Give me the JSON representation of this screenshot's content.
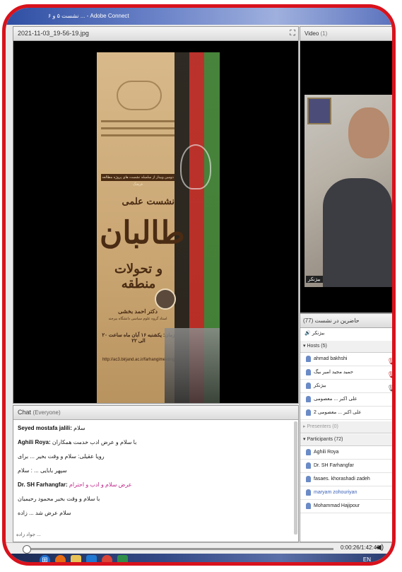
{
  "window": {
    "title": "نشست ۵ و ۶ ... - Adobe Connect"
  },
  "share": {
    "title": "2021-11-03_19-56-19.jpg",
    "fullscreen_icon": "expand-icon",
    "poster": {
      "series": "نشست علمی",
      "band": "دومین وبینار از سلسله نشست های پروژه مطالعه فرهنگ",
      "main_title": "طالبان",
      "subtitle": "و تحولات منطقه",
      "speaker": "دکتر احمد بخشی",
      "speaker_role": "استاد گروه علوم سیاسی دانشگاه بیرجند",
      "datetime": "زمان: یکشنبه ۱۶ آبان ماه ساعت ۲۰ الی ۲۲",
      "link": "http://ac3.birjand.ac.ir/farhangimeeting"
    }
  },
  "video": {
    "title": "Video",
    "count": "(1)",
    "speaker_label": "بیژنکر"
  },
  "attendees": {
    "title": "حاضرین در نشست",
    "count": "(77)",
    "speaking_now": "بیژنکر",
    "hosts_label": "Hosts (5)",
    "hosts": [
      {
        "name": "ahmad bakhshi",
        "mic": true
      },
      {
        "name": "حمید مجید امیر بیگ",
        "mic": true
      },
      {
        "name": "بیژنکر",
        "mic": true
      },
      {
        "name": "علی اکبر ... معصومی",
        "mic": false
      },
      {
        "name": "علی اکبر ... معصومی 2",
        "mic": false
      }
    ],
    "presenters_label": "Presenters (0)",
    "participants_label": "Participants (72)",
    "participants": [
      {
        "name": "Aghili Roya"
      },
      {
        "name": "Dr. SH Farhangfar"
      },
      {
        "name": "fasaes. khorashadi zadeh"
      },
      {
        "name": "maryam zohouriyan"
      },
      {
        "name": "Mohammad Hajipour"
      }
    ]
  },
  "chat": {
    "title": "Chat",
    "scope": "(Everyone)",
    "lines": [
      {
        "who": "Seyed mostafa jalili:",
        "msg": "سلام",
        "pink": false
      },
      {
        "who": "Aghili Roya:",
        "msg": "با سلام و عرض ادب خدمت همکاران",
        "pink": false
      },
      {
        "who": "",
        "msg": "رویا عقیلی: سلام و وقت بخیر ... برای",
        "pink": false
      },
      {
        "who": "",
        "msg": "سپهر بابایی ... : سلام",
        "pink": false
      },
      {
        "who": "Dr. SH Farhangfar:",
        "msg": "عرض سلام و ادب و احترام",
        "pink": true
      },
      {
        "who": "",
        "msg": "با سلام و وقت بخیر محمود رحیمیان",
        "pink": false
      },
      {
        "who": "",
        "msg": "سلام عرض شد ... زاده",
        "pink": false
      }
    ],
    "input_text": "جواد زاده ..."
  },
  "playback": {
    "time": "0:00:26/1:42:40",
    "volume_icon": "speaker-icon"
  },
  "taskbar": {
    "icons": [
      "start-orb-icon",
      "firefox-icon",
      "file-explorer-icon",
      "outlook-icon",
      "chrome-icon",
      "app-icon"
    ],
    "tray_text": "EN"
  },
  "colors": {
    "frame": "#d8121c",
    "titlebar": "#2f4fa3"
  }
}
